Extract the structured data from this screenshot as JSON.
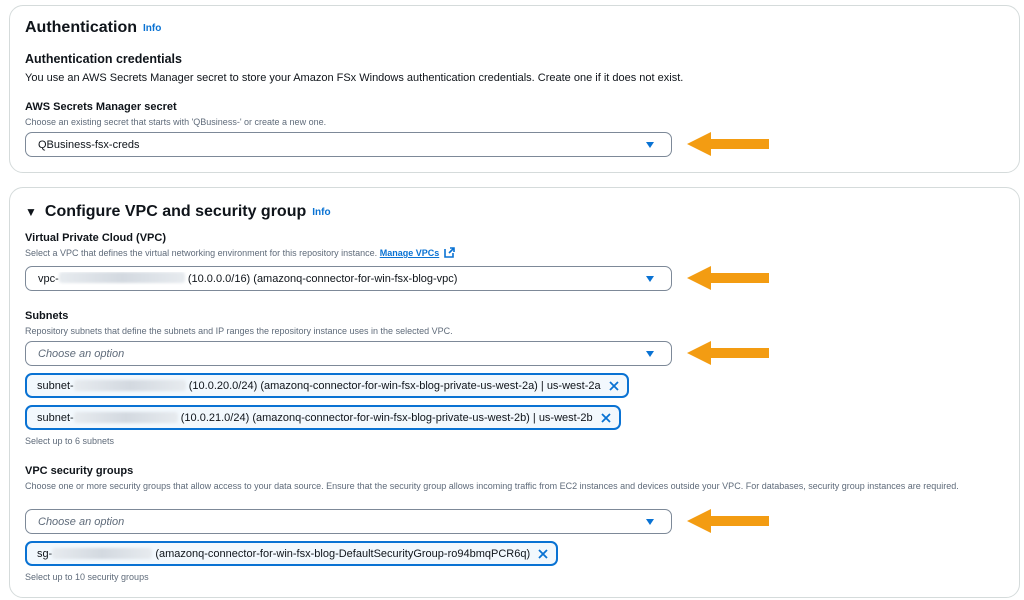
{
  "auth": {
    "title": "Authentication",
    "info": "Info",
    "subtitle": "Authentication credentials",
    "description": "You use an AWS Secrets Manager secret to store your Amazon FSx Windows authentication credentials. Create one if it does not exist.",
    "secret_label": "AWS Secrets Manager secret",
    "secret_desc": "Choose an existing secret that starts with 'QBusiness-' or create a new one.",
    "secret_value": "QBusiness-fsx-creds"
  },
  "vpc": {
    "title": "Configure VPC and security group",
    "info": "Info",
    "vpc_label": "Virtual Private Cloud (VPC)",
    "vpc_desc": "Select a VPC that defines the virtual networking environment for this repository instance.",
    "manage_link": "Manage VPCs",
    "vpc_prefix": "vpc-",
    "vpc_suffix": "(10.0.0.0/16) (amazonq-connector-for-win-fsx-blog-vpc)",
    "subnets_label": "Subnets",
    "subnets_desc": "Repository subnets that define the subnets and IP ranges the repository instance uses in the selected VPC.",
    "subnets_placeholder": "Choose an option",
    "subnet_tokens": [
      {
        "prefix": "subnet-",
        "suffix": "(10.0.20.0/24) (amazonq-connector-for-win-fsx-blog-private-us-west-2a) | us-west-2a"
      },
      {
        "prefix": "subnet-",
        "suffix": "(10.0.21.0/24) (amazonq-connector-for-win-fsx-blog-private-us-west-2b) | us-west-2b"
      }
    ],
    "subnets_hint": "Select up to 6 subnets",
    "sg_label": "VPC security groups",
    "sg_desc": "Choose one or more security groups that allow access to your data source. Ensure that the security group allows incoming traffic from EC2 instances and devices outside your VPC. For databases, security group instances are required.",
    "sg_placeholder": "Choose an option",
    "sg_token": {
      "prefix": "sg-",
      "suffix": "(amazonq-connector-for-win-fsx-blog-DefaultSecurityGroup-ro94bmqPCR6q)"
    },
    "sg_hint": "Select up to 10 security groups"
  },
  "colors": {
    "accent": "#0972d3",
    "arrow": "#f39c12",
    "border": "#7d8998"
  },
  "icons": [
    "caret-down-icon",
    "external-link-icon",
    "close-icon",
    "orange-arrow-annotation",
    "expand-triangle-icon"
  ]
}
